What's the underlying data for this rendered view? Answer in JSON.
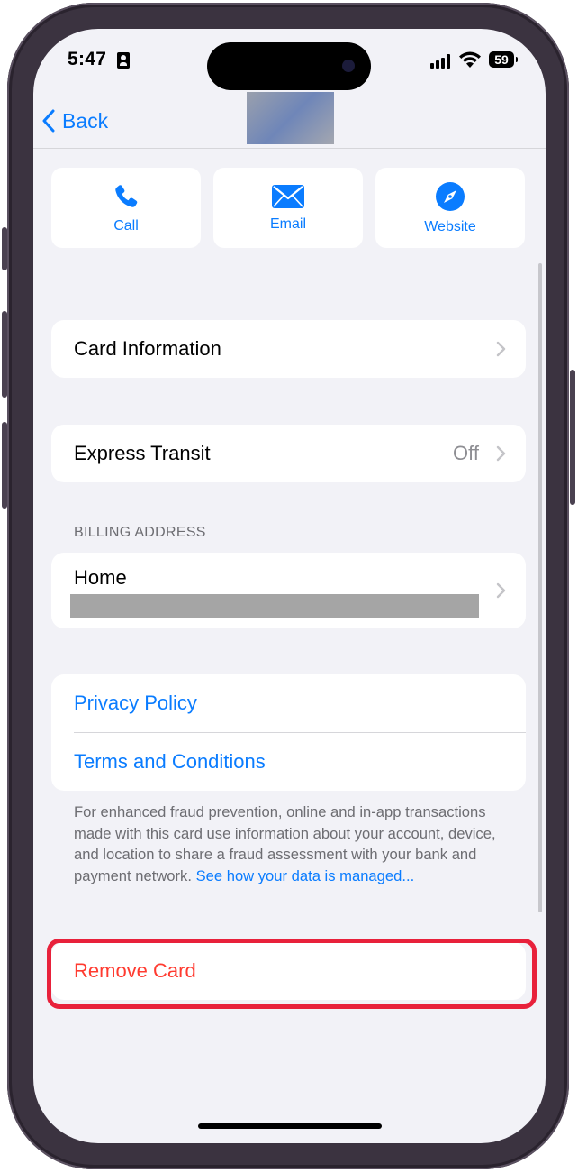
{
  "status_bar": {
    "time": "5:47",
    "battery": "59"
  },
  "nav": {
    "back_label": "Back"
  },
  "actions": [
    {
      "label": "Call",
      "icon": "phone-icon"
    },
    {
      "label": "Email",
      "icon": "envelope-icon"
    },
    {
      "label": "Website",
      "icon": "compass-icon"
    }
  ],
  "card_information": {
    "label": "Card Information"
  },
  "express_transit": {
    "label": "Express Transit",
    "value": "Off"
  },
  "billing": {
    "header": "BILLING ADDRESS",
    "title": "Home"
  },
  "links": {
    "privacy": "Privacy Policy",
    "terms": "Terms and Conditions"
  },
  "footnote": {
    "text": "For enhanced fraud prevention, online and in-app transactions made with this card use information about your account, device, and location to share a fraud assessment with your bank and payment network. ",
    "link": "See how your data is managed..."
  },
  "remove": {
    "label": "Remove Card"
  },
  "colors": {
    "accent": "#0a7cff",
    "destructive": "#ff3b30",
    "highlight": "#e8213b",
    "background": "#f2f2f7"
  }
}
